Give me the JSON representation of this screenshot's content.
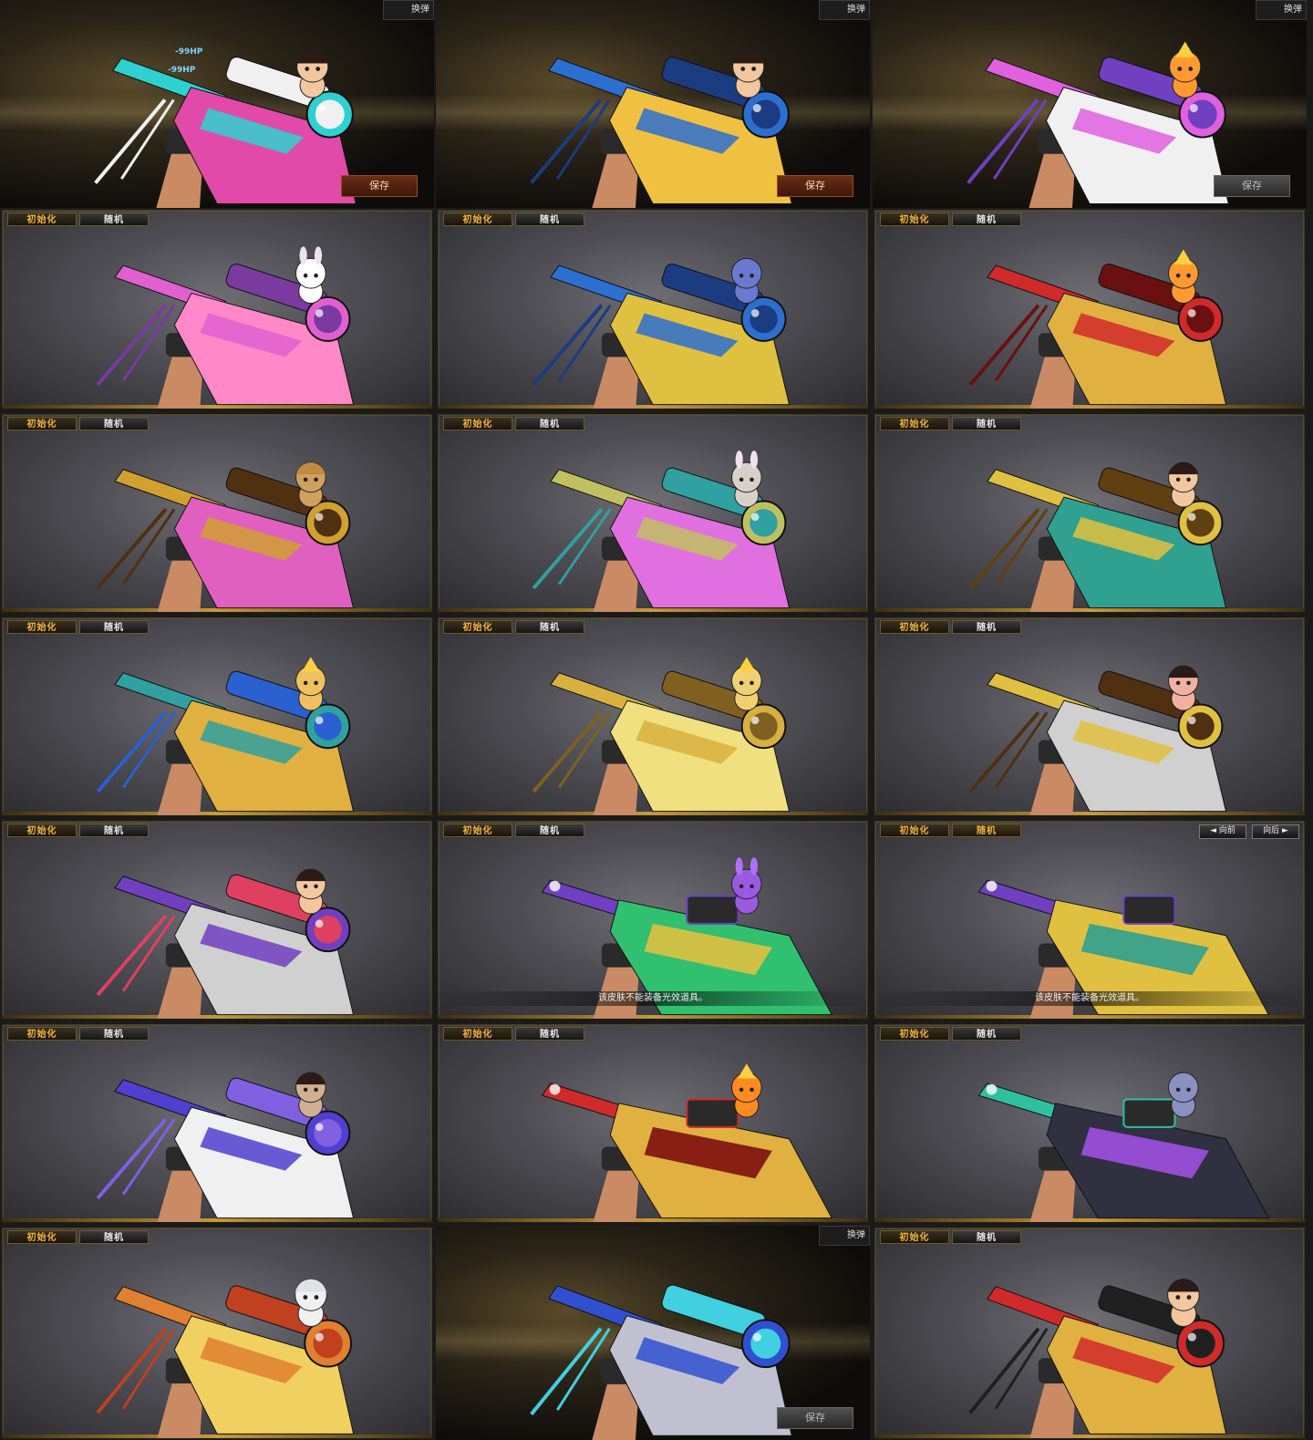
{
  "labels": {
    "init_tab": "初始化",
    "random_tab": "随机",
    "reload_button": "换弹",
    "save_button": "保存",
    "hp_damage": "-99HP",
    "notice": "该皮肤不能装备光效道具。",
    "prev_label": "◄ 向前",
    "next_label": "向后 ►"
  },
  "panels": [
    {
      "kind": "dark",
      "reload": true,
      "save": "orange",
      "hp": true,
      "gun": "sniper",
      "colors": [
        "#2fd0d0",
        "#e14aa8",
        "#f0f0f0"
      ],
      "pet": "girl",
      "petcolor": "#f2c7a0"
    },
    {
      "kind": "dark",
      "reload": true,
      "save": "orange",
      "gun": "sniper",
      "colors": [
        "#2d6fd0",
        "#f0c040",
        "#1b3c80"
      ],
      "pet": "girl",
      "petcolor": "#f2c7a0"
    },
    {
      "kind": "dark",
      "reload": true,
      "save": "gray",
      "gun": "sniper",
      "colors": [
        "#e060e0",
        "#f0f0f0",
        "#7040c0"
      ],
      "pet": "phoenix",
      "petcolor": "#ff9a30"
    },
    {
      "kind": "gray",
      "gun": "sniper",
      "colors": [
        "#e060d0",
        "#ff88c8",
        "#7a3aa0"
      ],
      "pet": "bunny",
      "petcolor": "#ffffff"
    },
    {
      "kind": "gray",
      "gun": "sniper",
      "colors": [
        "#2d6fd0",
        "#e0c040",
        "#1b3c80"
      ],
      "pet": "dragon",
      "petcolor": "#6a7ad0"
    },
    {
      "kind": "gray",
      "gun": "sniper",
      "colors": [
        "#d02a2a",
        "#e0b040",
        "#6a1010"
      ],
      "pet": "phoenix",
      "petcolor": "#ff9a30"
    },
    {
      "kind": "gray",
      "gun": "sniper",
      "colors": [
        "#d0a030",
        "#e060c0",
        "#503010"
      ],
      "pet": "goggles",
      "petcolor": "#d0a060"
    },
    {
      "kind": "gray",
      "gun": "sniper",
      "colors": [
        "#c0c060",
        "#e070e0",
        "#30a0a0"
      ],
      "pet": "bunnyhood",
      "petcolor": "#d8d0c8"
    },
    {
      "kind": "gray",
      "gun": "sniper",
      "colors": [
        "#e0c040",
        "#30a090",
        "#604010"
      ],
      "pet": "girl",
      "petcolor": "#f2c7a0"
    },
    {
      "kind": "gray",
      "gun": "sniper",
      "colors": [
        "#30a0a0",
        "#e0b040",
        "#2a60d0"
      ],
      "pet": "phoenix",
      "petcolor": "#f0c060"
    },
    {
      "kind": "gray",
      "gun": "sniper",
      "colors": [
        "#d8b040",
        "#f0e080",
        "#806020"
      ],
      "pet": "phoenix",
      "petcolor": "#f0d070"
    },
    {
      "kind": "gray",
      "gun": "sniper",
      "colors": [
        "#e0c040",
        "#d0d0d0",
        "#503010"
      ],
      "pet": "girl",
      "petcolor": "#f2b0a0"
    },
    {
      "kind": "gray",
      "gun": "sniper",
      "colors": [
        "#7040c0",
        "#d0d0d0",
        "#e04060"
      ],
      "pet": "girl",
      "petcolor": "#f2c7a0"
    },
    {
      "kind": "gray",
      "notice": true,
      "gun": "rifle",
      "colors": [
        "#7040c0",
        "#30c070",
        "#e0c040"
      ],
      "pet": "purplegirl",
      "petcolor": "#9a5ae0"
    },
    {
      "kind": "gray",
      "notice": true,
      "nav": true,
      "randOn": true,
      "gun": "rifle",
      "colors": [
        "#7040c0",
        "#e0c040",
        "#30a090"
      ],
      "pet": "none"
    },
    {
      "kind": "gray",
      "gun": "sniper",
      "colors": [
        "#5040d0",
        "#f0f0f0",
        "#8060e0"
      ],
      "pet": "boy",
      "petcolor": "#d0b090"
    },
    {
      "kind": "gray",
      "gun": "rifle",
      "colors": [
        "#d02a2a",
        "#e0b040",
        "#801010"
      ],
      "pet": "phoenix",
      "petcolor": "#ff8a20"
    },
    {
      "kind": "gray",
      "gun": "rifle",
      "colors": [
        "#30c0a0",
        "#303040",
        "#a050e0"
      ],
      "pet": "frog",
      "petcolor": "#8a90c0"
    },
    {
      "kind": "gray",
      "gun": "sniper",
      "colors": [
        "#e08030",
        "#f0d060",
        "#c04020"
      ],
      "pet": "whitegirl",
      "petcolor": "#f0f0f0"
    },
    {
      "kind": "dark",
      "reload": true,
      "save": "gray",
      "gun": "sniper",
      "colors": [
        "#3050d0",
        "#c0c0d0",
        "#40d0e0"
      ],
      "pet": "none"
    },
    {
      "kind": "gray",
      "gun": "sniper",
      "colors": [
        "#d02a2a",
        "#e0b040",
        "#202020"
      ],
      "pet": "girl",
      "petcolor": "#f2c7a0"
    }
  ]
}
